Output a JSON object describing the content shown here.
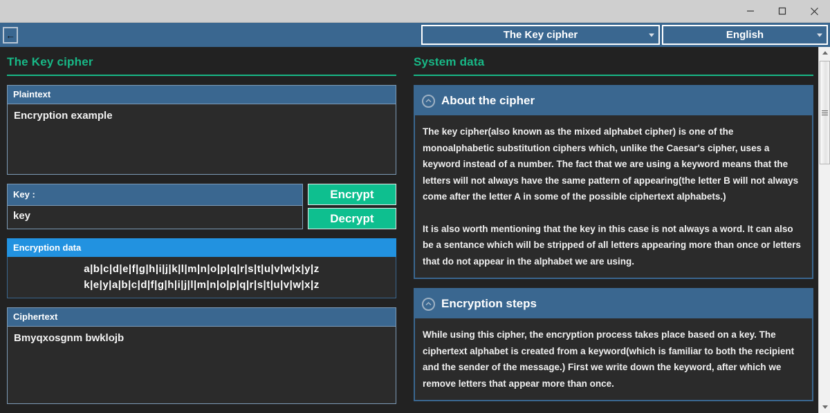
{
  "window": {
    "minimize_label": "minimize-icon",
    "maximize_label": "maximize-icon",
    "close_label": "close-icon"
  },
  "navbar": {
    "back_icon": "←",
    "cipher_select": {
      "value": "The Key cipher",
      "caret": "chevron-down-icon"
    },
    "language_select": {
      "value": "English",
      "caret": "chevron-down-icon"
    }
  },
  "left": {
    "title": "The Key cipher",
    "plaintext": {
      "label": "Plaintext",
      "value": "Encryption example"
    },
    "key": {
      "label": "Key :",
      "value": "key"
    },
    "buttons": {
      "encrypt": "Encrypt",
      "decrypt": "Decrypt"
    },
    "encryption_data": {
      "label": "Encryption data",
      "plain_alphabet": "a|b|c|d|e|f|g|h|i|j|k|l|m|n|o|p|q|r|s|t|u|v|w|x|y|z",
      "cipher_alphabet": "k|e|y|a|b|c|d|f|g|h|i|j|l|m|n|o|p|q|r|s|t|u|v|w|x|z"
    },
    "ciphertext": {
      "label": "Ciphertext",
      "value": "Bmyqxosgnm bwklojb"
    }
  },
  "right": {
    "title": "System data",
    "sections": [
      {
        "heading": "About the cipher",
        "toggle_icon": "chevron-up-icon",
        "paragraphs": [
          "The key cipher(also known as the mixed alphabet cipher) is one of the monoalphabetic substitution ciphers which, unlike the Caesar's cipher, uses a keyword instead of a number. The fact that we are using a keyword means that the letters will not always have the same pattern of appearing(the letter B will not always come after the letter A in some of the possible ciphertext alphabets.)",
          "It is also worth mentioning that the key in this case is not always a word. It can also be a sentance which will be stripped of all letters appearing more than once or letters that do not appear in the alphabet we are using."
        ]
      },
      {
        "heading": "Encryption steps",
        "toggle_icon": "chevron-up-icon",
        "paragraphs": [
          "While using this cipher, the encryption process takes place based on a key. The ciphertext alphabet is created from a keyword(which is familiar to both the recipient and the sender of the message.) First we write down the keyword, after which we remove letters  that appear more than once."
        ]
      }
    ]
  },
  "colors": {
    "accent_green": "#18b987",
    "button_green": "#0ebf8f",
    "header_blue": "#3a6790",
    "bright_blue": "#2292e0",
    "background": "#222222",
    "field_background": "#2b2b2b"
  }
}
